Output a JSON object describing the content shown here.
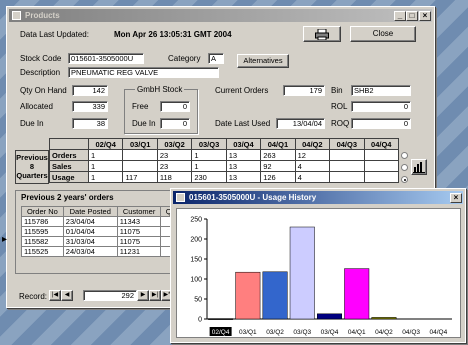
{
  "products_window": {
    "title": "Products",
    "data_last_updated_label": "Data Last Updated:",
    "data_last_updated_value": "Mon Apr 26 13:05:31 GMT 2004",
    "print_icon": "printer-icon",
    "close_label": "Close",
    "stock_code_label": "Stock Code",
    "stock_code_value": "015601-3505000U",
    "category_label": "Category",
    "category_value": "A",
    "alternatives_label": "Alternatives",
    "description_label": "Description",
    "description_value": "PNEUMATIC REG VALVE",
    "qty_on_hand_label": "Qty On Hand",
    "qty_on_hand_value": "142",
    "allocated_label": "Allocated",
    "allocated_value": "339",
    "due_in_label": "Due In",
    "due_in_value": "38",
    "gmbh_stock_label": "GmbH Stock",
    "free_label": "Free",
    "free_value": "0",
    "gmbh_due_in_label": "Due In",
    "gmbh_due_in_value": "0",
    "current_orders_label": "Current Orders",
    "current_orders_value": "179",
    "date_last_used_label": "Date Last Used",
    "date_last_used_value": "13/04/04",
    "bin_label": "Bin",
    "bin_value": "SHB2",
    "rol_label": "ROL",
    "rol_value": "0",
    "roq_label": "ROQ",
    "roq_value": "0",
    "quarters": {
      "side_label_1": "Previous",
      "side_label_2": "8",
      "side_label_3": "Quarters",
      "headers": [
        "02/Q4",
        "03/Q1",
        "03/Q2",
        "03/Q3",
        "03/Q4",
        "04/Q1",
        "04/Q2",
        "04/Q3",
        "04/Q4"
      ],
      "rows": [
        {
          "label": "Orders",
          "cells": [
            "1",
            "",
            "23",
            "1",
            "13",
            "263",
            "12",
            "",
            ""
          ]
        },
        {
          "label": "Sales",
          "cells": [
            "1",
            "",
            "23",
            "1",
            "13",
            "92",
            "4",
            "",
            ""
          ]
        },
        {
          "label": "Usage",
          "cells": [
            "1",
            "117",
            "118",
            "230",
            "13",
            "126",
            "4",
            "",
            ""
          ]
        }
      ]
    },
    "orders_title": "Previous 2 years' orders",
    "orders_headers": [
      "Order No",
      "Date Posted",
      "Customer",
      "Qt"
    ],
    "orders_rows": [
      [
        "115786",
        "23/04/04",
        "11343",
        ""
      ],
      [
        "115595",
        "01/04/04",
        "11075",
        ""
      ],
      [
        "115582",
        "31/03/04",
        "11075",
        ""
      ],
      [
        "115525",
        "24/03/04",
        "11231",
        ""
      ]
    ],
    "record_label": "Record:",
    "record_value": "292"
  },
  "usage_window": {
    "title": "015601-3505000U - Usage History",
    "close_glyph": "×"
  },
  "chart_data": {
    "type": "bar",
    "categories": [
      "02/Q4",
      "03/Q1",
      "03/Q2",
      "03/Q3",
      "03/Q4",
      "04/Q1",
      "04/Q2",
      "04/Q3",
      "04/Q4"
    ],
    "values": [
      1,
      117,
      118,
      230,
      13,
      126,
      4,
      0,
      0
    ],
    "colors": [
      "#000000",
      "#ff7f7f",
      "#3366cc",
      "#ccccff",
      "#000080",
      "#ff00ff",
      "#808000",
      "#3366cc",
      "#3366cc"
    ],
    "ylim": [
      0,
      250
    ],
    "yticks": [
      0,
      50,
      100,
      150,
      200,
      250
    ],
    "title": "",
    "xlabel": "",
    "ylabel": "",
    "grid": false
  }
}
